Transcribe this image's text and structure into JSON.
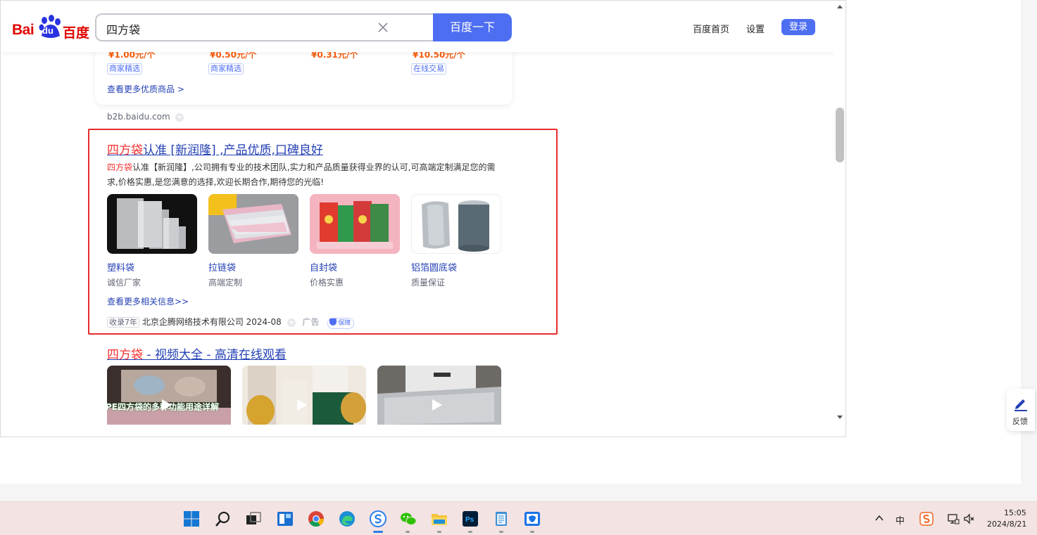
{
  "header": {
    "logo_bai": "Bai",
    "logo_du": "du",
    "logo_cn": "百度",
    "search_value": "四方袋",
    "search_button": "百度一下",
    "nav_home": "百度首页",
    "nav_settings": "设置",
    "login": "登录"
  },
  "b2b_card": {
    "prices": [
      "¥1.00元/个",
      "¥0.50元/个",
      "¥0.31元/个",
      "¥10.50元/个"
    ],
    "tags": [
      "商家精选",
      "商家精选",
      "在线交易"
    ],
    "more": "查看更多优质商品 >",
    "url": "b2b.baidu.com"
  },
  "ad": {
    "title_kw": "四方袋",
    "title_rest": "认准 [新润隆] ,产品优质,口碑良好",
    "desc_kw": "四方袋",
    "desc_rest": "认准【新润隆】,公司拥有专业的技术团队,实力和产品质量获得业界的认可,可高端定制满足您的需求,价格实惠,是您满意的选择,欢迎长期合作,期待您的光临!",
    "products": [
      {
        "name": "塑料袋",
        "sub": "诚信厂家"
      },
      {
        "name": "拉链袋",
        "sub": "高端定制"
      },
      {
        "name": "自封袋",
        "sub": "价格实惠"
      },
      {
        "name": "铝箔圆底袋",
        "sub": "质量保证"
      }
    ],
    "more": "查看更多相关信息>>",
    "record": "收录7年",
    "company": "北京企腾网络技术有限公司 2024-08",
    "ad_label": "广告",
    "guard": "保障"
  },
  "video": {
    "title_kw": "四方袋",
    "title_rest": " - 视频大全 - 高清在线观看",
    "caption1": "PE四方袋的多种功能用途详解"
  },
  "feedback": "反馈",
  "taskbar": {
    "ime": "中",
    "time": "15:05",
    "date": "2024/8/21"
  },
  "colors": {
    "brand_blue": "#4e6ef2",
    "link_blue": "#2440b3",
    "keyword_red": "#f73131",
    "price_orange": "#f55a0b",
    "highlight_red": "#e82c2c"
  }
}
